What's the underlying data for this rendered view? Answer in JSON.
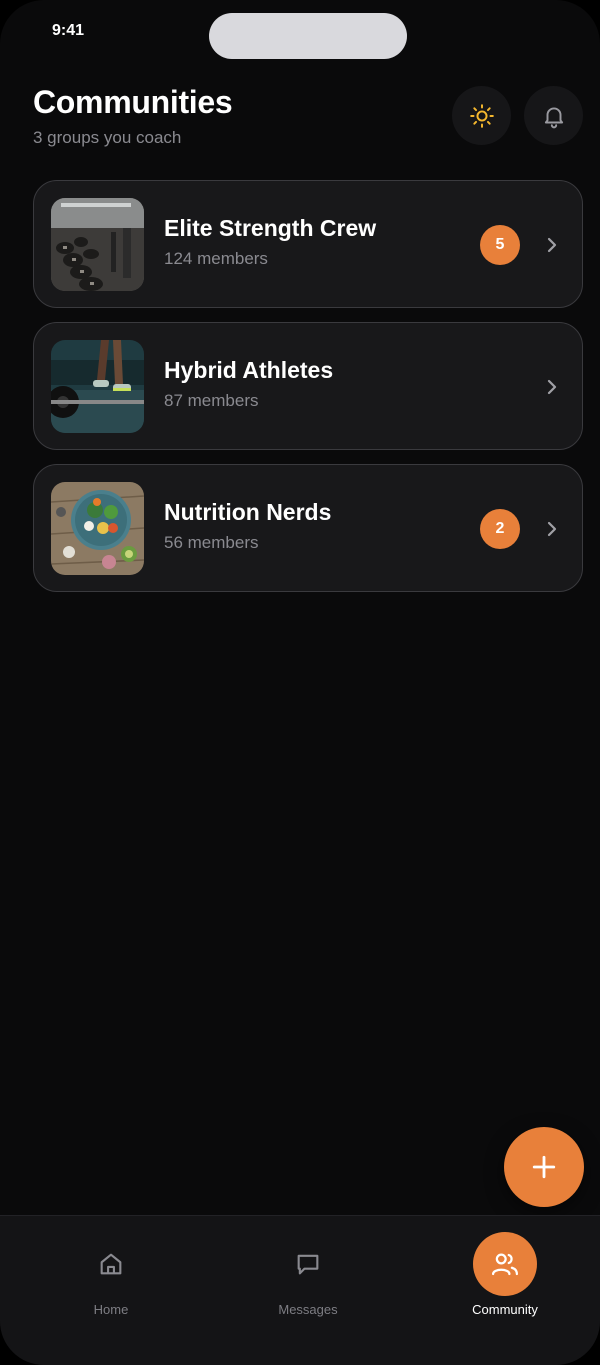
{
  "status_bar": {
    "time": "9:41"
  },
  "header": {
    "title": "Communities",
    "subtitle": "3 groups you coach"
  },
  "communities": [
    {
      "name": "Elite Strength Crew",
      "members": "124 members",
      "badge": "5",
      "thumb": "gym-dumbbells-photo"
    },
    {
      "name": "Hybrid Athletes",
      "members": "87 members",
      "badge": "",
      "thumb": "barbell-lift-photo"
    },
    {
      "name": "Nutrition Nerds",
      "members": "56 members",
      "badge": "2",
      "thumb": "healthy-food-bowl-photo"
    }
  ],
  "tabs": [
    {
      "label": "Home",
      "icon": "home-icon",
      "active": false
    },
    {
      "label": "Messages",
      "icon": "message-icon",
      "active": false
    },
    {
      "label": "Community",
      "icon": "users-icon",
      "active": true
    }
  ],
  "colors": {
    "accent": "#e8803a",
    "background": "#0a0a0b",
    "card": "#18181a",
    "sun": "#f5b82e"
  }
}
